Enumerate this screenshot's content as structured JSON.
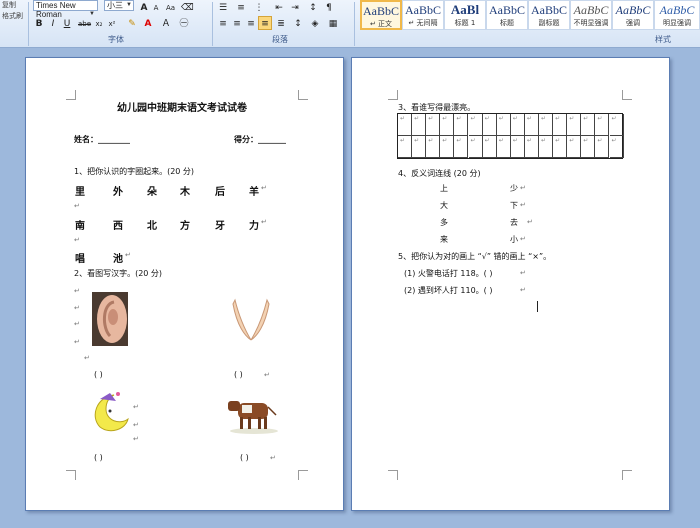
{
  "ribbon": {
    "clipboard_partial": [
      "复制",
      "格式刷"
    ],
    "font_name": "Times New Roman",
    "font_size": "小三",
    "group_labels": {
      "font": "字体",
      "paragraph": "段落",
      "styles": "样式"
    },
    "font_buttons": [
      "B",
      "I",
      "U",
      "abe",
      "x₂",
      "x²",
      "Aa",
      "A",
      "A"
    ],
    "styles": [
      {
        "sample": "AaBbC",
        "name": "↵ 正文"
      },
      {
        "sample": "AaBbC",
        "name": "↵ 无间隔"
      },
      {
        "sample": "AaBl",
        "name": "标题 1"
      },
      {
        "sample": "AaBbC",
        "name": "标题"
      },
      {
        "sample": "AaBbC",
        "name": "副标题"
      },
      {
        "sample": "AaBbC",
        "name": "不明显强调"
      },
      {
        "sample": "AaBbC",
        "name": "强调"
      },
      {
        "sample": "AaBbC",
        "name": "明显强调"
      }
    ]
  },
  "page1": {
    "title": "幼儿园中班期末语文考试试卷",
    "name_label": "姓名：________",
    "score_label": "得分：_______",
    "q1": "1、把你认识的字圈起来。(20 分)",
    "row1": [
      "里",
      "外",
      "朵",
      "木",
      "后",
      "羊"
    ],
    "row2": [
      "南",
      "西",
      "北",
      "方",
      "牙",
      "力"
    ],
    "row3": [
      "唱",
      "池"
    ],
    "q2": "2、看图写汉字。(20 分)",
    "paren": "(      )",
    "para": "↵"
  },
  "page2": {
    "q3": "3、看谁写得最漂亮。",
    "q4": "4、反义词连线 (20 分)",
    "left_words": [
      "上",
      "大",
      "多",
      "来"
    ],
    "right_words": [
      "少",
      "下",
      "去",
      "小"
    ],
    "q5": "5、把你认为对的画上 “√” 错的画上 “×”。",
    "s1": "(1) 火警电话打 118。(        )",
    "s2": "(2) 遇到坏人打 110。(        )",
    "para": "↵"
  }
}
